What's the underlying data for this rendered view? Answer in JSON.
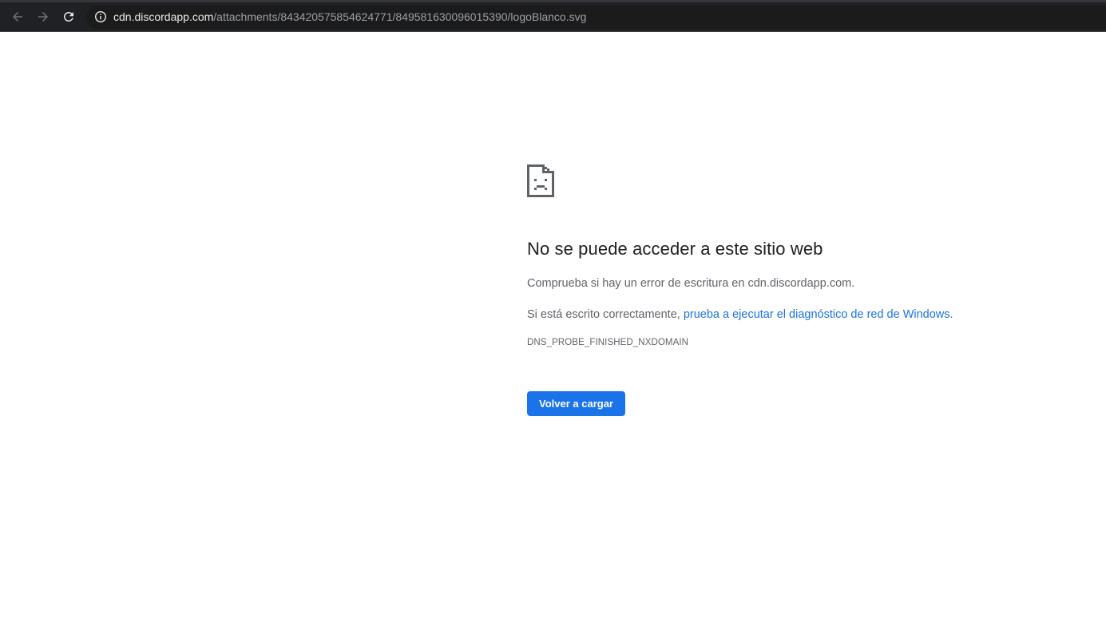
{
  "browser": {
    "url_host": "cdn.discordapp.com",
    "url_path": "/attachments/843420575854624771/849581630096015390/logoBlanco.svg",
    "icons": {
      "back": "arrow-left-icon",
      "forward": "arrow-right-icon",
      "reload": "reload-icon",
      "info": "info-icon"
    }
  },
  "error": {
    "icon": "sad-page-icon",
    "title": "No se puede acceder a este sitio web",
    "line1": "Comprueba si hay un error de escritura en cdn.discordapp.com.",
    "line2_prefix": "Si está escrito correctamente, ",
    "line2_link": "prueba a ejecutar el diagnóstico de red de Windows",
    "line2_suffix": ".",
    "code": "DNS_PROBE_FINISHED_NXDOMAIN",
    "reload_button": "Volver a cargar"
  },
  "colors": {
    "toolbar": "#202124",
    "link": "#1a73e8",
    "button": "#1a73e8",
    "title": "#202124",
    "text": "#5f6368"
  }
}
